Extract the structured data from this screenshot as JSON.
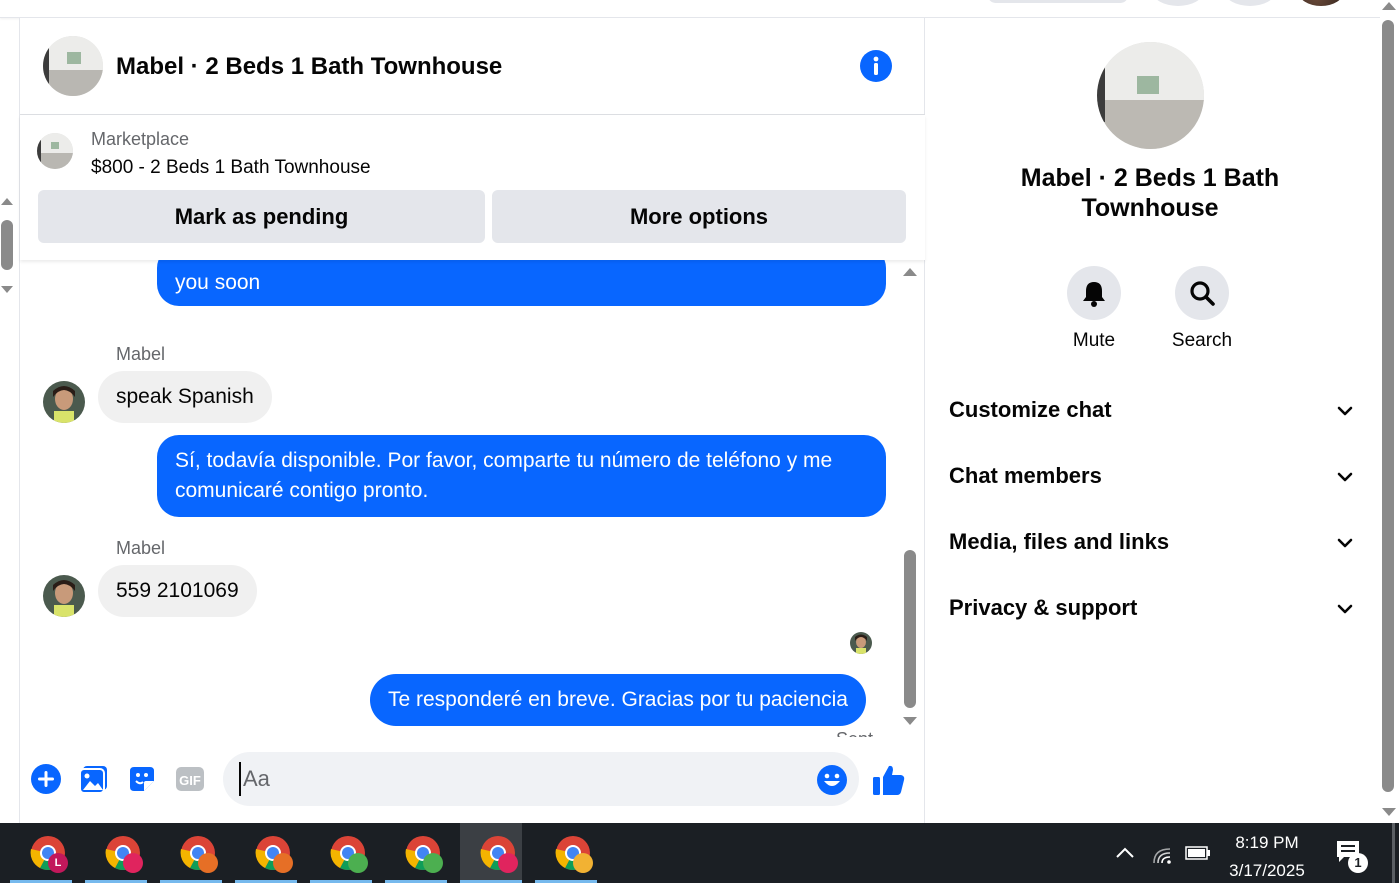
{
  "chat": {
    "title": "Mabel · 2 Beds 1 Bath Townhouse",
    "marketplace_label": "Marketplace",
    "listing_title": "$800 - 2 Beds 1 Bath Townhouse",
    "mark_pending_label": "Mark as pending",
    "more_options_label": "More options",
    "messages": [
      {
        "direction": "out",
        "text": "you soon"
      },
      {
        "direction": "in",
        "sender": "Mabel",
        "text": "speak Spanish"
      },
      {
        "direction": "out",
        "text": "Sí, todavía disponible. Por favor, comparte tu número de teléfono y me comunicaré contigo pronto."
      },
      {
        "direction": "in",
        "sender": "Mabel",
        "text": "559 2101069"
      },
      {
        "direction": "out",
        "text": "Te responderé en breve. Gracias por tu paciencia"
      }
    ],
    "status": "Sent",
    "composer_placeholder": "Aa"
  },
  "info_panel": {
    "title": "Mabel · 2 Beds 1 Bath Townhouse",
    "actions": [
      {
        "label": "Mute",
        "icon": "bell-icon"
      },
      {
        "label": "Search",
        "icon": "search-icon"
      }
    ],
    "sections": [
      "Customize chat",
      "Chat members",
      "Media, files and links",
      "Privacy & support"
    ]
  },
  "taskbar": {
    "time": "8:19 PM",
    "date": "3/17/2025",
    "notification_count": "1",
    "apps": [
      {
        "icon": "chrome-icon",
        "profile_badge": "L"
      },
      {
        "icon": "chrome-icon",
        "profile_badge": ""
      },
      {
        "icon": "chrome-icon",
        "profile_badge": ""
      },
      {
        "icon": "chrome-icon",
        "profile_badge": ""
      },
      {
        "icon": "chrome-icon",
        "profile_badge": ""
      },
      {
        "icon": "chrome-icon",
        "profile_badge": ""
      },
      {
        "icon": "chrome-icon",
        "profile_badge": ""
      },
      {
        "icon": "chrome-icon",
        "profile_badge": ""
      }
    ]
  },
  "colors": {
    "messenger_blue": "#0866ff",
    "incoming_bubble": "#f0f0f0",
    "button_gray": "#e4e6eb",
    "taskbar": "#1b1f24"
  }
}
